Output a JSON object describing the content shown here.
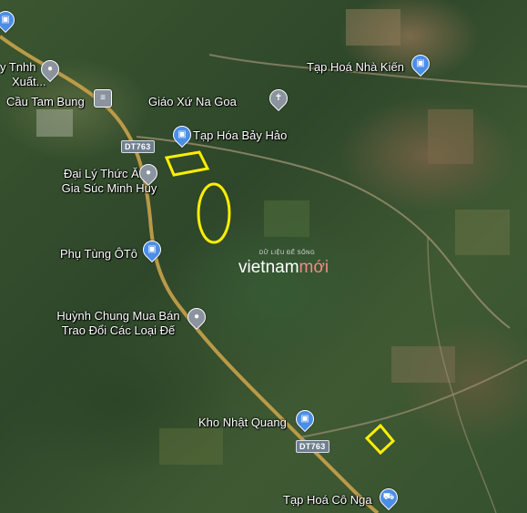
{
  "map": {
    "places": [
      {
        "id": "ty-tnhh",
        "text": "y Tnhh",
        "icon": "gray-pin-icon"
      },
      {
        "id": "xuat",
        "text": "Xuất...",
        "icon": ""
      },
      {
        "id": "cau-tam-bung",
        "text": "Cầu Tam Bung",
        "icon": "bridge-icon"
      },
      {
        "id": "giao-xu-na-goa",
        "text": "Giáo Xứ Na Goa",
        "icon": "church-icon"
      },
      {
        "id": "tap-hoa-nha-kien",
        "text": "Tạp Hoá Nhà Kiến",
        "icon": "shopping-bag-icon"
      },
      {
        "id": "tap-hoa-bay-hao",
        "text": "Tạp Hóa Bảy Hảo",
        "icon": "shopping-bag-icon"
      },
      {
        "id": "dai-ly-line1",
        "text": "Đại Lý Thức Ăn",
        "icon": "gray-pin-icon"
      },
      {
        "id": "dai-ly-line2",
        "text": "Gia Súc Minh Huy",
        "icon": ""
      },
      {
        "id": "phu-tung-oto",
        "text": "Phụ Tùng ÔTô",
        "icon": "shopping-bag-icon"
      },
      {
        "id": "huynh-chung-line1",
        "text": "Huỳnh Chung Mua Bán",
        "icon": "gray-pin-icon"
      },
      {
        "id": "huynh-chung-line2",
        "text": "Trao Đổi Các Loại Đế",
        "icon": ""
      },
      {
        "id": "kho-nhat-quang",
        "text": "Kho Nhật Quang",
        "icon": "shopping-bag-icon"
      },
      {
        "id": "tap-hoa-co-nga",
        "text": "Tạp Hoá Cô Nga",
        "icon": "shopping-cart-icon"
      }
    ],
    "roads": [
      {
        "id": "dt763-north",
        "text": "DT763"
      },
      {
        "id": "dt763-south",
        "text": "DT763"
      }
    ],
    "highlight_color": "#ffee00",
    "road_color": "#c9a24a"
  },
  "watermark": {
    "tagline": "DỮ LIỆU ĐỂ SỐNG",
    "brand_main": "vietnam",
    "brand_accent": "mới"
  }
}
